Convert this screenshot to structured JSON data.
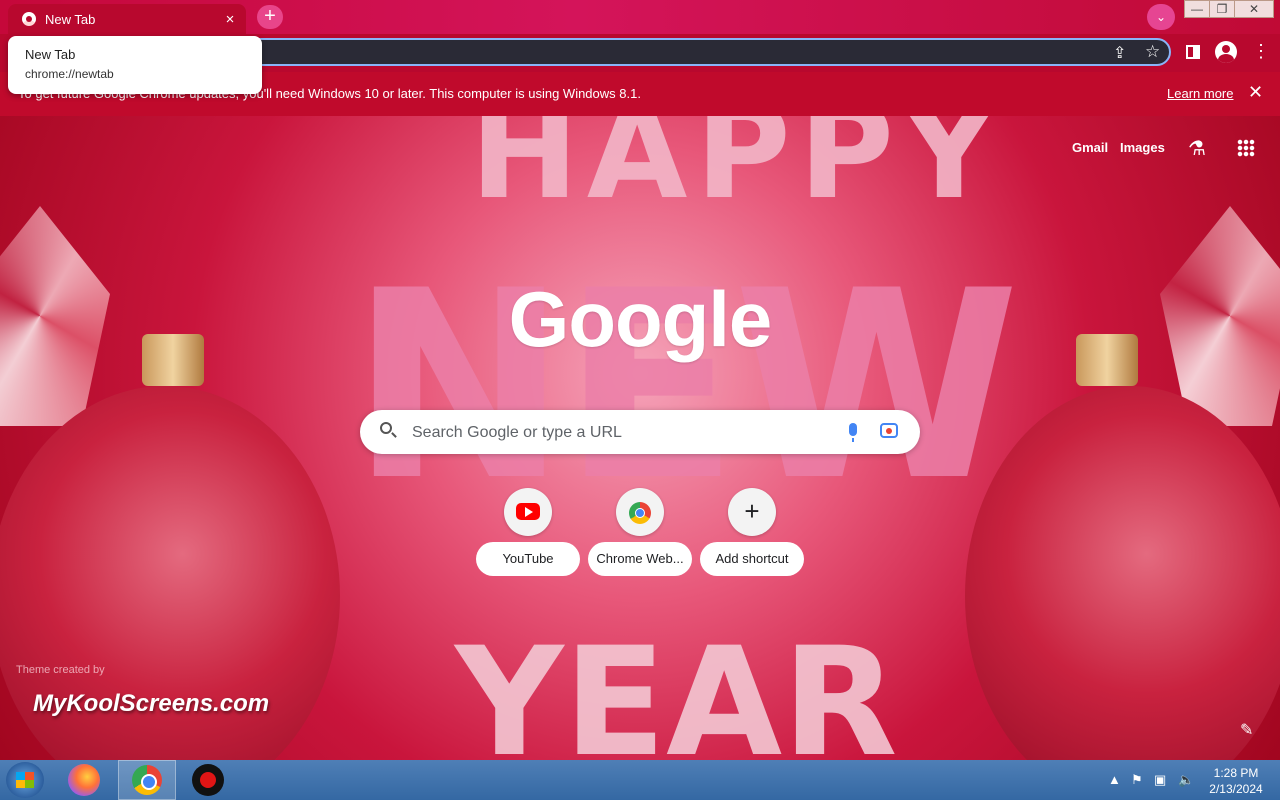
{
  "window": {
    "tab_title": "New Tab",
    "tab_close": "×",
    "new_tab": "+",
    "tab_search": "⌄",
    "controls": {
      "minimize": "—",
      "maximize": "❐",
      "close": "✕"
    }
  },
  "tooltip": {
    "title": "New Tab",
    "url": "chrome://newtab"
  },
  "infobar": {
    "message": "To get future Google Chrome updates, you'll need Windows 10 or later. This computer is using Windows 8.1.",
    "learn_more": "Learn more",
    "close": "✕"
  },
  "toolbar": {
    "share_icon": "⇪",
    "star_icon": "☆",
    "menu_icon": "⋮"
  },
  "ntp": {
    "top_links": {
      "gmail": "Gmail",
      "images": "Images"
    },
    "labs_icon": "⚗",
    "logo": "Google",
    "search": {
      "placeholder": "Search Google or type a URL"
    },
    "shortcuts": [
      {
        "label": "YouTube"
      },
      {
        "label": "Chrome Web..."
      },
      {
        "label": "Add shortcut",
        "glyph": "+"
      }
    ],
    "theme_credit_small": "Theme created by",
    "theme_credit": "MyKoolScreens.com",
    "edit_icon": "✎",
    "background_text": {
      "top": "HAPPY",
      "middle": "NEW",
      "bottom": "YEAR"
    }
  },
  "taskbar": {
    "tray": {
      "up": "▲",
      "flag": "⚑",
      "net": "▣",
      "vol": "🔈"
    },
    "time": "1:28 PM",
    "date": "2/13/2024"
  },
  "colors": {
    "accent": "#b8082e",
    "focus": "#8ab4f8"
  }
}
